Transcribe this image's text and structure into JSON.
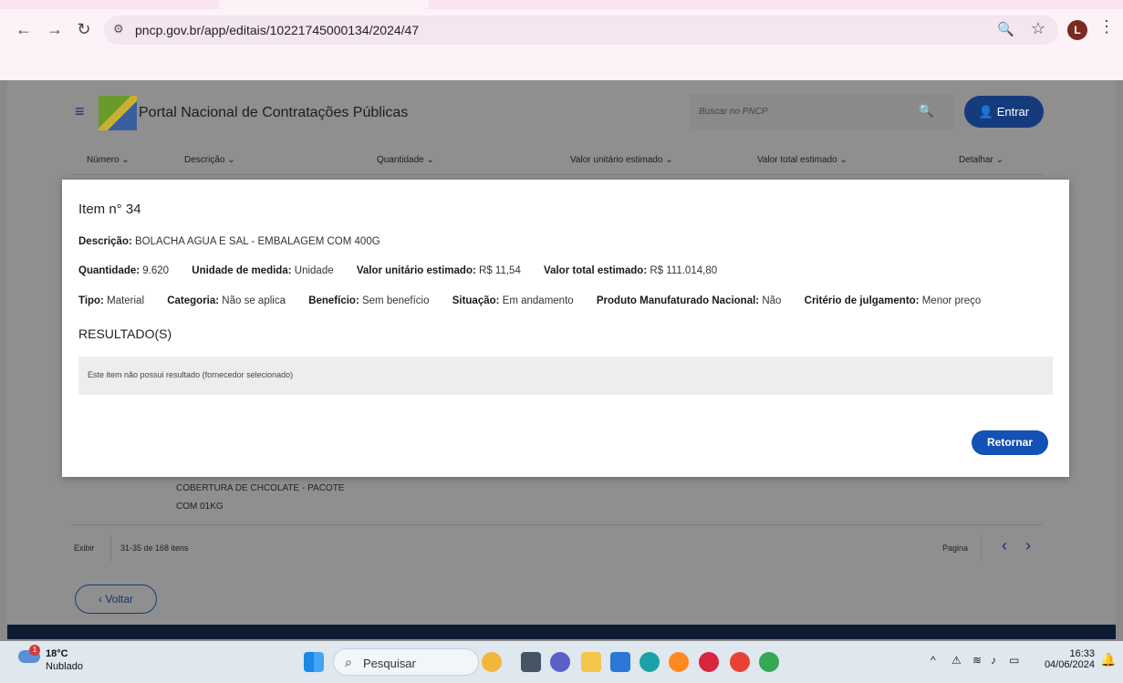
{
  "browser": {
    "url": "pncp.gov.br/app/editais/10221745000134/2024/47",
    "profile_initial": "L"
  },
  "header": {
    "title": "Portal Nacional de Contratações Públicas",
    "search_placeholder": "Buscar no PNCP",
    "login_label": "Entrar"
  },
  "table": {
    "columns": [
      "Número ⌄",
      "Descrição ⌄",
      "Quantidade ⌄",
      "Valor unitário estimado ⌄",
      "Valor total estimado ⌄",
      "Detalhar ⌄"
    ],
    "row_text_line1": "COBERTURA DE CHCOLATE - PACOTE",
    "row_text_line2": "COM 01KG"
  },
  "pager": {
    "exibir": "Exibir",
    "range": "31-35 de 168 itens",
    "pagina": "Pagina",
    "prev": "‹",
    "next": "›"
  },
  "back_label": "Voltar",
  "modal": {
    "title": "Item n° 34",
    "descricao_label": "Descrição:",
    "descricao_value": "BOLACHA AGUA E SAL - EMBALAGEM COM 400G",
    "quantidade_label": "Quantidade:",
    "quantidade_value": "9.620",
    "unidade_label": "Unidade de medida:",
    "unidade_value": "Unidade",
    "valor_unit_label": "Valor unitário estimado:",
    "valor_unit_value": "R$ 11,54",
    "valor_total_label": "Valor total estimado:",
    "valor_total_value": "R$ 111.014,80",
    "tipo_label": "Tipo:",
    "tipo_value": "Material",
    "categoria_label": "Categoria:",
    "categoria_value": "Não se aplica",
    "beneficio_label": "Benefício:",
    "beneficio_value": "Sem benefício",
    "situacao_label": "Situação:",
    "situacao_value": "Em andamento",
    "produto_label": "Produto Manufaturado Nacional:",
    "produto_value": "Não",
    "criterio_label": "Critério de julgamento:",
    "criterio_value": "Menor preço",
    "resultados_title": "RESULTADO(S)",
    "resultados_empty": "Este item não possui resultado (fornecedor selecionado)",
    "retornar_label": "Retornar"
  },
  "taskbar": {
    "weather_temp": "18°C",
    "weather_cond": "Nublado",
    "weather_badge": "1",
    "search_label": "Pesquisar",
    "time": "16:33",
    "date": "04/06/2024"
  }
}
